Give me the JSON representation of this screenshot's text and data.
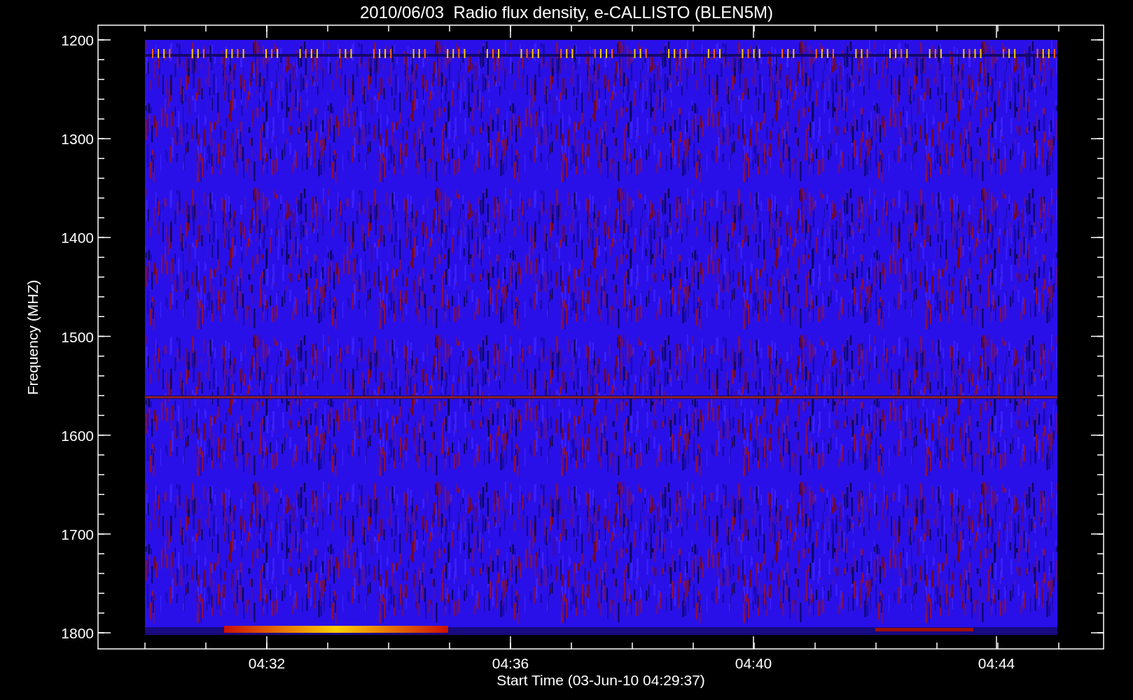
{
  "title": "2010/06/03  Radio flux density, e-CALLISTO (BLEN5M)",
  "plot": {
    "ylabel": "Frequency (MHZ)",
    "xlabel": "Start Time (03-Jun-10 04:29:37)",
    "yticks": [
      "1200",
      "1300",
      "1400",
      "1500",
      "1600",
      "1700",
      "1800"
    ],
    "xticks": [
      "04:32",
      "04:36",
      "04:40",
      "04:44"
    ]
  }
}
